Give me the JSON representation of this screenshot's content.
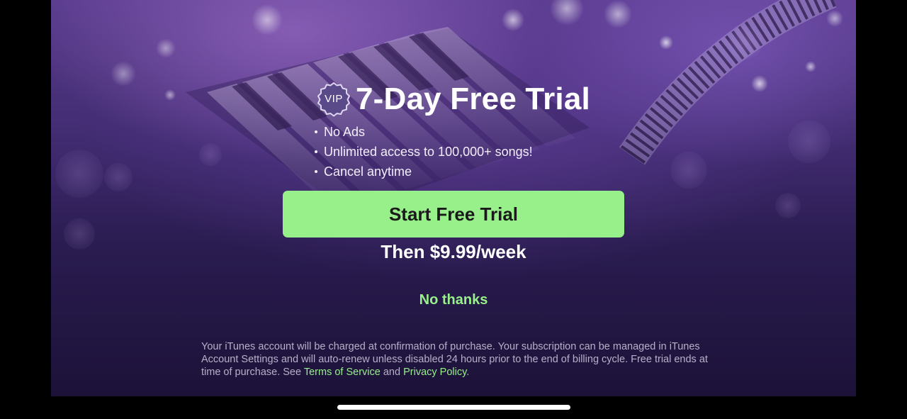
{
  "paywall": {
    "badge_text": "VIP",
    "title": "7-Day Free Trial",
    "features": [
      "No Ads",
      "Unlimited access to 100,000+ songs!",
      "Cancel anytime"
    ],
    "cta_label": "Start Free Trial",
    "price_text": "Then $9.99/week",
    "dismiss_label": "No thanks",
    "legal": {
      "text": "Your iTunes account will be charged at confirmation of purchase. Your subscription can be managed in iTunes Account Settings and will auto-renew unless disabled 24 hours prior to the end of billing cycle. Free trial ends at time of purchase. See",
      "terms_link": "Terms of Service",
      "and_text": "and",
      "privacy_link": "Privacy Policy",
      "end_text": "."
    }
  },
  "icons": {
    "badge": "vip-badge-icon",
    "background": "piano-keyboard-art"
  },
  "colors": {
    "accent": "#98f08a",
    "background_top": "#5a3c8e",
    "background_bottom": "#1c1238",
    "text_primary": "#ffffff",
    "text_legal": "#b7b0c8"
  }
}
